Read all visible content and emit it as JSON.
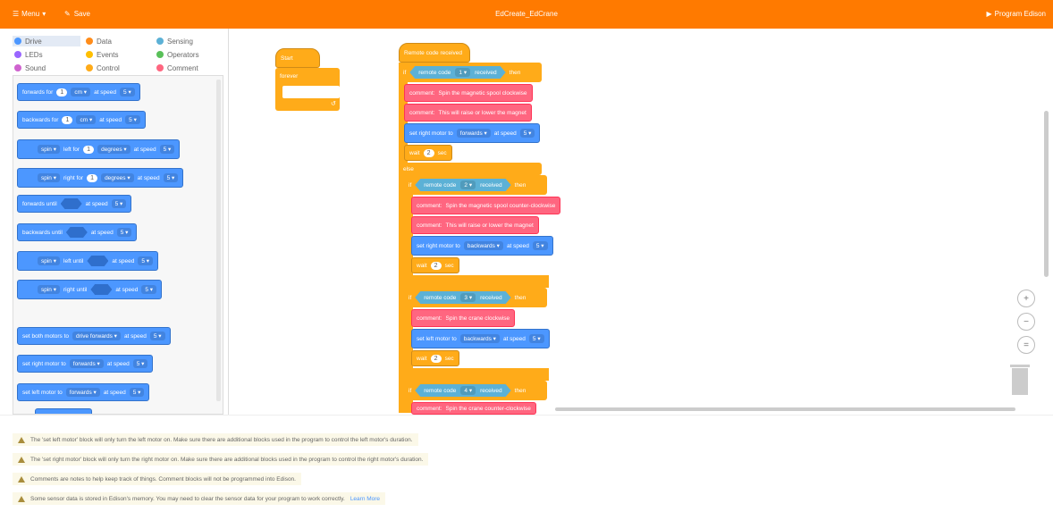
{
  "topbar": {
    "menu_label": "Menu",
    "save_label": "Save",
    "title": "EdCreate_EdCrane",
    "program_label": "Program Edison"
  },
  "categories": [
    {
      "label": "Drive",
      "color": "#4c97ff",
      "active": true
    },
    {
      "label": "Data",
      "color": "#ff8c1a"
    },
    {
      "label": "Sensing",
      "color": "#5cb1d6"
    },
    {
      "label": "LEDs",
      "color": "#9966ff"
    },
    {
      "label": "Events",
      "color": "#ffbf00"
    },
    {
      "label": "Operators",
      "color": "#59c059"
    },
    {
      "label": "Sound",
      "color": "#cf63cf"
    },
    {
      "label": "Control",
      "color": "#ffab19"
    },
    {
      "label": "Comment",
      "color": "#ff6680"
    }
  ],
  "palette": {
    "forwards_for": {
      "label": "forwards for",
      "value": "1",
      "unit": "cm",
      "speed_label": "at speed",
      "speed": "5"
    },
    "backwards_for": {
      "label": "backwards for",
      "value": "1",
      "unit": "cm",
      "speed_label": "at speed",
      "speed": "5"
    },
    "spin_left": {
      "label": "spin",
      "dir": "left for",
      "value": "1",
      "unit": "degrees",
      "speed_label": "at speed",
      "speed": "5"
    },
    "spin_right": {
      "label": "spin",
      "dir": "right for",
      "value": "1",
      "unit": "degrees",
      "speed_label": "at speed",
      "speed": "5"
    },
    "forwards_until": {
      "label": "forwards until",
      "speed_label": "at speed",
      "speed": "5"
    },
    "backwards_until": {
      "label": "backwards until",
      "speed_label": "at speed",
      "speed": "5"
    },
    "spin_left_until": {
      "label": "spin",
      "dir": "left until",
      "speed_label": "at speed",
      "speed": "5"
    },
    "spin_right_until": {
      "label": "spin",
      "dir": "right until",
      "speed_label": "at speed",
      "speed": "5"
    },
    "set_both": {
      "label": "set both motors to",
      "mode": "drive forwards",
      "speed_label": "at speed",
      "speed": "5"
    },
    "set_right": {
      "label": "set right motor to",
      "mode": "forwards",
      "speed_label": "at speed",
      "speed": "5"
    },
    "set_left": {
      "label": "set left motor to",
      "mode": "forwards",
      "speed_label": "at speed",
      "speed": "5"
    }
  },
  "workspace": {
    "start": {
      "label": "Start",
      "forever": "forever"
    },
    "remote_hat": "Remote code received",
    "if1": {
      "if": "if",
      "cond": "remote code",
      "code": "1",
      "received": "received",
      "then": "then"
    },
    "c1": {
      "label": "comment:",
      "text": "Spin the magnetic spool clockwise"
    },
    "c2": {
      "label": "comment:",
      "text": "This will raise or lower the magnet"
    },
    "m1": {
      "label": "set right motor to",
      "mode": "forwards",
      "speed_label": "at speed",
      "speed": "5"
    },
    "w1": {
      "label": "wait",
      "value": "2",
      "unit": "sec"
    },
    "else_label": "else",
    "if2": {
      "if": "if",
      "cond": "remote code",
      "code": "2",
      "received": "received",
      "then": "then"
    },
    "c3": {
      "label": "comment:",
      "text": "Spin the magnetic spool counter-clockwise"
    },
    "c4": {
      "label": "comment:",
      "text": "This will raise or lower the magnet"
    },
    "m2": {
      "label": "set right motor to",
      "mode": "backwards",
      "speed_label": "at speed",
      "speed": "5"
    },
    "w2": {
      "label": "wait",
      "value": "2",
      "unit": "sec"
    },
    "if3": {
      "if": "if",
      "cond": "remote code",
      "code": "3",
      "received": "received",
      "then": "then"
    },
    "c5": {
      "label": "comment:",
      "text": "Spin the crane clockwise"
    },
    "m3": {
      "label": "set left motor to",
      "mode": "backwards",
      "speed_label": "at speed",
      "speed": "5"
    },
    "w3": {
      "label": "wait",
      "value": "2",
      "unit": "sec"
    },
    "if4": {
      "if": "if",
      "cond": "remote code",
      "code": "4",
      "received": "received",
      "then": "then"
    },
    "c6": {
      "label": "comment:",
      "text": "Spin the crane counter-clockwise"
    }
  },
  "zoom": {
    "in": "+",
    "out": "−",
    "reset": "="
  },
  "messages": [
    "The 'set left motor' block will only turn the left motor on. Make sure there are additional blocks used in the program to control the left motor's duration.",
    "The 'set right motor' block will only turn the right motor on. Make sure there are additional blocks used in the program to control the right motor's duration.",
    "Comments are notes to help keep track of things. Comment blocks will not be programmed into Edison.",
    "Some sensor data is stored in Edison's memory. You may need to clear the sensor data for your program to work correctly."
  ],
  "learn_more": "Learn More"
}
